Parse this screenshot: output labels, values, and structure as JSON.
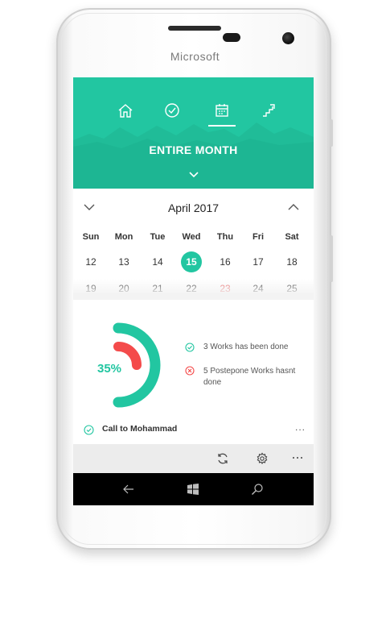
{
  "device": {
    "brand": "Microsoft"
  },
  "header": {
    "nav_icons": [
      "home-icon",
      "check-circle-icon",
      "calendar-icon",
      "stairs-icon"
    ],
    "active_nav": "calendar-icon",
    "title": "ENTIRE MONTH",
    "accent_color": "#22c6a1"
  },
  "calendar": {
    "month_label": "April 2017",
    "weekdays": [
      "Sun",
      "Mon",
      "Tue",
      "Wed",
      "Thu",
      "Fri",
      "Sat"
    ],
    "week1": [
      "12",
      "13",
      "14",
      "15",
      "16",
      "17",
      "18"
    ],
    "week2": [
      "19",
      "20",
      "21",
      "22",
      "23",
      "24",
      "25"
    ],
    "selected_day": "15",
    "highlight_color": "#e85a5a"
  },
  "stats": {
    "percent": "35%",
    "done_text": "3 Works has been done",
    "postpone_text_line1": "5 Postepone Works hasnt",
    "postpone_text_line2": "done",
    "done_color": "#22c6a1",
    "postpone_color": "#f44b4b"
  },
  "task": {
    "label": "Call to Mohammad",
    "more": "..."
  },
  "appbar": {
    "icons": [
      "sync-icon",
      "settings-icon",
      "more-icon"
    ]
  },
  "navbar": {
    "icons": [
      "back-icon",
      "windows-icon",
      "search-icon"
    ]
  }
}
